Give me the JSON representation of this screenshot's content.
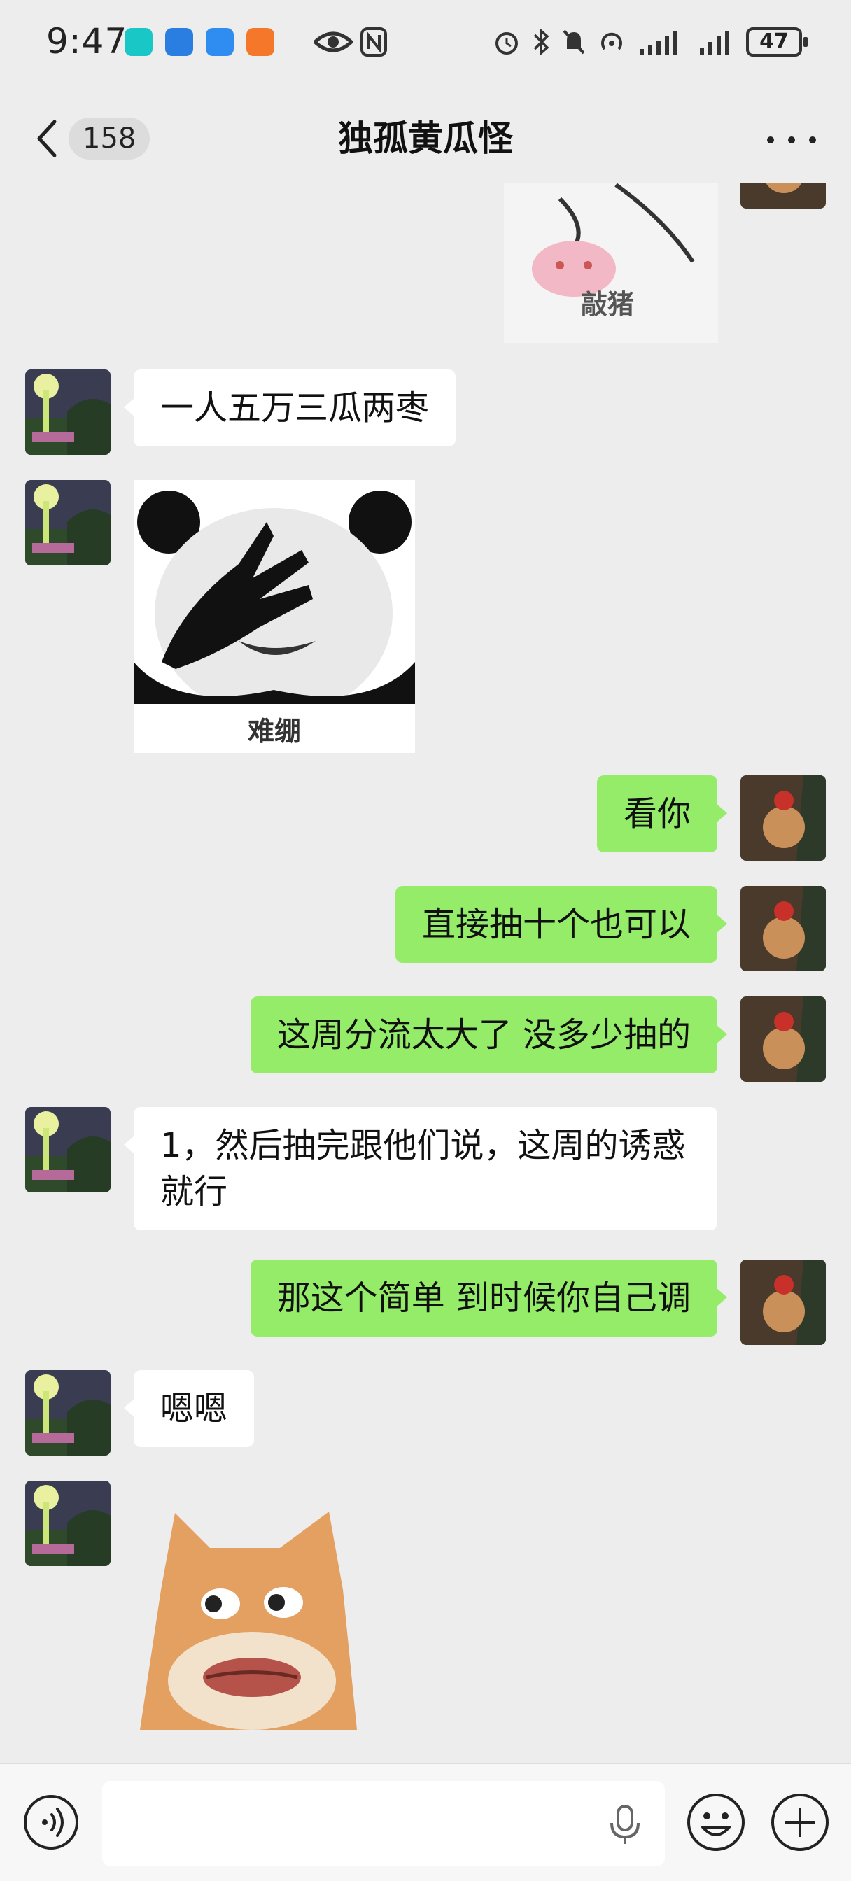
{
  "status_bar": {
    "time": "9:47",
    "battery": "47",
    "app_icons": [
      "taptap-icon",
      "browser-icon",
      "weather-icon",
      "taobao-icon"
    ],
    "indicators": [
      "eye-icon",
      "nfc-icon",
      "alarm-icon",
      "bluetooth-icon",
      "mute-bell-icon",
      "hotspot-icon",
      "signal-icon",
      "signal-icon"
    ]
  },
  "nav": {
    "unread_count": "158",
    "title": "独孤黄瓜怪"
  },
  "messages": [
    {
      "type": "sticker",
      "side": "out",
      "caption": "敲猪"
    },
    {
      "type": "text",
      "side": "in",
      "text": "一人五万三瓜两枣"
    },
    {
      "type": "sticker",
      "side": "in",
      "caption": "难绷"
    },
    {
      "type": "text",
      "side": "out",
      "text": "看你"
    },
    {
      "type": "text",
      "side": "out",
      "text": "直接抽十个也可以"
    },
    {
      "type": "text",
      "side": "out",
      "text": "这周分流太大了 没多少抽的"
    },
    {
      "type": "text",
      "side": "in",
      "text": "1，然后抽完跟他们说，这周的诱惑就行"
    },
    {
      "type": "text",
      "side": "out",
      "text": "那这个简单 到时候你自己调"
    },
    {
      "type": "text",
      "side": "in",
      "text": "嗯嗯"
    },
    {
      "type": "sticker",
      "side": "in",
      "caption": ""
    }
  ],
  "input_bar": {
    "placeholder": "",
    "icons": [
      "voice-icon",
      "mic-icon",
      "emoji-icon",
      "plus-icon"
    ]
  },
  "colors": {
    "background": "#ededed",
    "outgoing_bubble": "#95ec69",
    "incoming_bubble": "#ffffff"
  }
}
